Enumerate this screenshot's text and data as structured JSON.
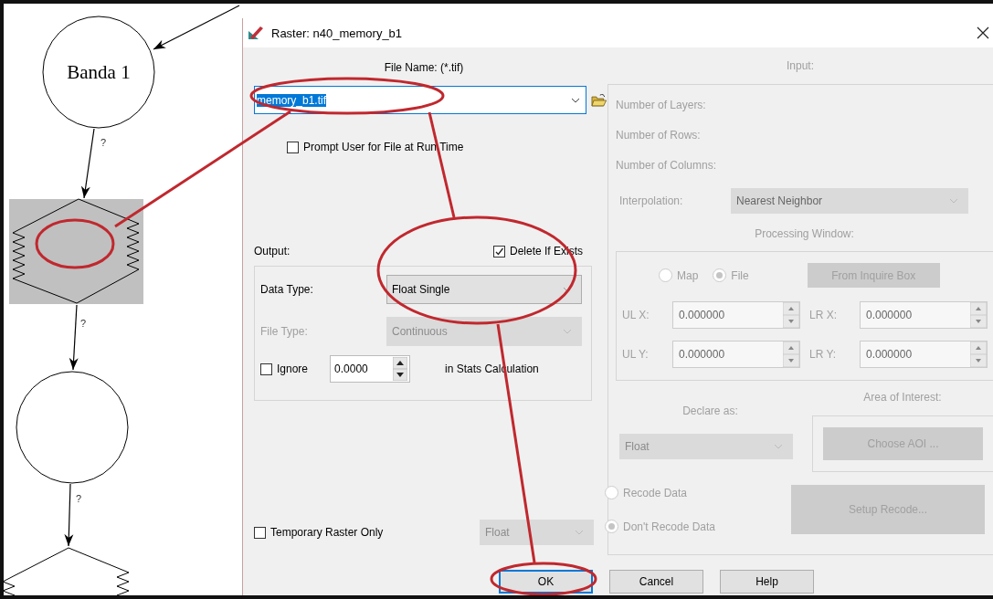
{
  "diagram": {
    "nodes": [
      {
        "kind": "circle",
        "label": "Banda 1",
        "selected": false
      },
      {
        "kind": "function",
        "selected": true
      },
      {
        "kind": "circle",
        "selected": false
      },
      {
        "kind": "function",
        "selected": false
      }
    ],
    "connectors": [
      {
        "label": "?"
      },
      {
        "label": "?"
      },
      {
        "label": "?"
      }
    ]
  },
  "dialog": {
    "title": "Raster:  n40_memory_b1",
    "file_name_label": "File Name: (*.tif)",
    "file_name": {
      "value": "memory_b1.tif",
      "selected": true
    },
    "prompt": {
      "label": "Prompt User for File at Run Time",
      "checked": false
    },
    "output": {
      "label": "Output:",
      "delete_if_exists": {
        "label": "Delete If Exists",
        "checked": true
      },
      "fields": [
        {
          "label": "Data Type:",
          "value": "Float Single",
          "disabled": false
        },
        {
          "label": "File Type:",
          "value": "Continuous",
          "disabled": true
        }
      ],
      "ignore": {
        "label": "Ignore",
        "checked": false,
        "value": "0.0000",
        "suffix": "in Stats Calculation"
      }
    },
    "temporary": {
      "label": "Temporary Raster Only",
      "checked": false,
      "value": "Float",
      "disabled": true
    },
    "input": {
      "label": "Input:",
      "disabled": true,
      "info": [
        "Number of Layers:",
        "Number of Rows:",
        "Number of Columns:"
      ],
      "interpolation": {
        "label": "Interpolation:",
        "value": "Nearest Neighbor"
      },
      "processing_window": {
        "label": "Processing Window:",
        "options": [
          {
            "label": "Map",
            "selected": false
          },
          {
            "label": "File",
            "selected": true
          }
        ],
        "button": "From Inquire Box",
        "coords": [
          {
            "label": "UL X:",
            "value": "0.000000"
          },
          {
            "label": "LR X:",
            "value": "0.000000"
          },
          {
            "label": "UL Y:",
            "value": "0.000000"
          },
          {
            "label": "LR Y:",
            "value": "0.000000"
          }
        ]
      },
      "declare": {
        "label": "Declare as:",
        "value": "Float"
      },
      "aoi": {
        "label": "Area of Interest:",
        "button": "Choose AOI ..."
      },
      "recode": [
        {
          "label": "Recode Data",
          "selected": false
        },
        {
          "label": "Don't Recode Data",
          "selected": true
        }
      ],
      "setup_button": "Setup Recode..."
    },
    "buttons": [
      {
        "label": "OK",
        "default": true
      },
      {
        "label": "Cancel",
        "default": false
      },
      {
        "label": "Help",
        "default": false
      }
    ]
  }
}
